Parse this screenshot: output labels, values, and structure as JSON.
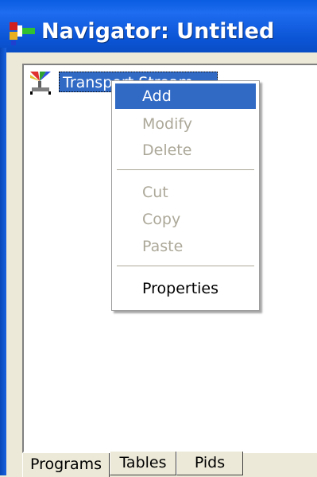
{
  "window": {
    "title": "Navigator: Untitled",
    "title_icon": "navigator-app-icon",
    "titlebar_color": "#0a5ce0"
  },
  "tree": {
    "items": [
      {
        "label": "Transport Stream",
        "icon": "transport-stream-icon",
        "selected": true
      }
    ]
  },
  "context_menu": {
    "items": [
      {
        "label": "Add",
        "enabled": true,
        "highlighted": true
      },
      {
        "label": "Modify",
        "enabled": false
      },
      {
        "label": "Delete",
        "enabled": false
      },
      {
        "label": "Cut",
        "enabled": false
      },
      {
        "label": "Copy",
        "enabled": false
      },
      {
        "label": "Paste",
        "enabled": false
      },
      {
        "label": "Properties",
        "enabled": true
      }
    ],
    "highlight_color": "#316ac5",
    "disabled_color": "#aca899"
  },
  "tabs": [
    {
      "label": "Programs",
      "active": true
    },
    {
      "label": "Tables",
      "active": false
    },
    {
      "label": "Pids",
      "active": false
    }
  ]
}
